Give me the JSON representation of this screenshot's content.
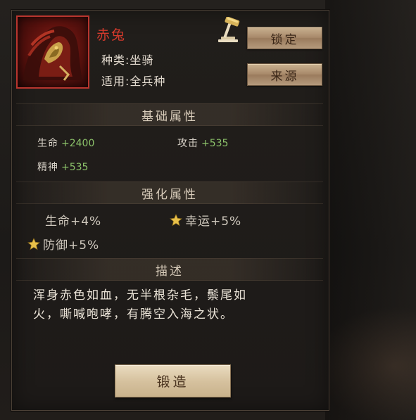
{
  "item": {
    "name": "赤兔",
    "type_line": "种类:坐骑",
    "usage_line": "适用:全兵种"
  },
  "buttons": {
    "lock": "锁定",
    "source": "来源",
    "forge": "锻造"
  },
  "sections": {
    "base": "基础属性",
    "enhance": "强化属性",
    "description": "描述"
  },
  "base_stats": [
    {
      "label": "生命",
      "value": "+2400"
    },
    {
      "label": "攻击",
      "value": "+535"
    },
    {
      "label": "精神",
      "value": "+535"
    }
  ],
  "enhance_stats": [
    {
      "text": "生命+4%",
      "starred": false
    },
    {
      "text": "幸运+5%",
      "starred": true
    },
    {
      "text": "防御+5%",
      "starred": true
    }
  ],
  "description": {
    "line1": "浑身赤色如血，无半根杂毛，鬃尾如",
    "line2": "火，嘶喊咆哮，有腾空入海之状。"
  },
  "icons": {
    "hammer": "hammer-icon",
    "star": "star-icon"
  },
  "colors": {
    "name": "#d23a2c",
    "stat_value": "#8cc26a",
    "star": "#e8c04a"
  }
}
